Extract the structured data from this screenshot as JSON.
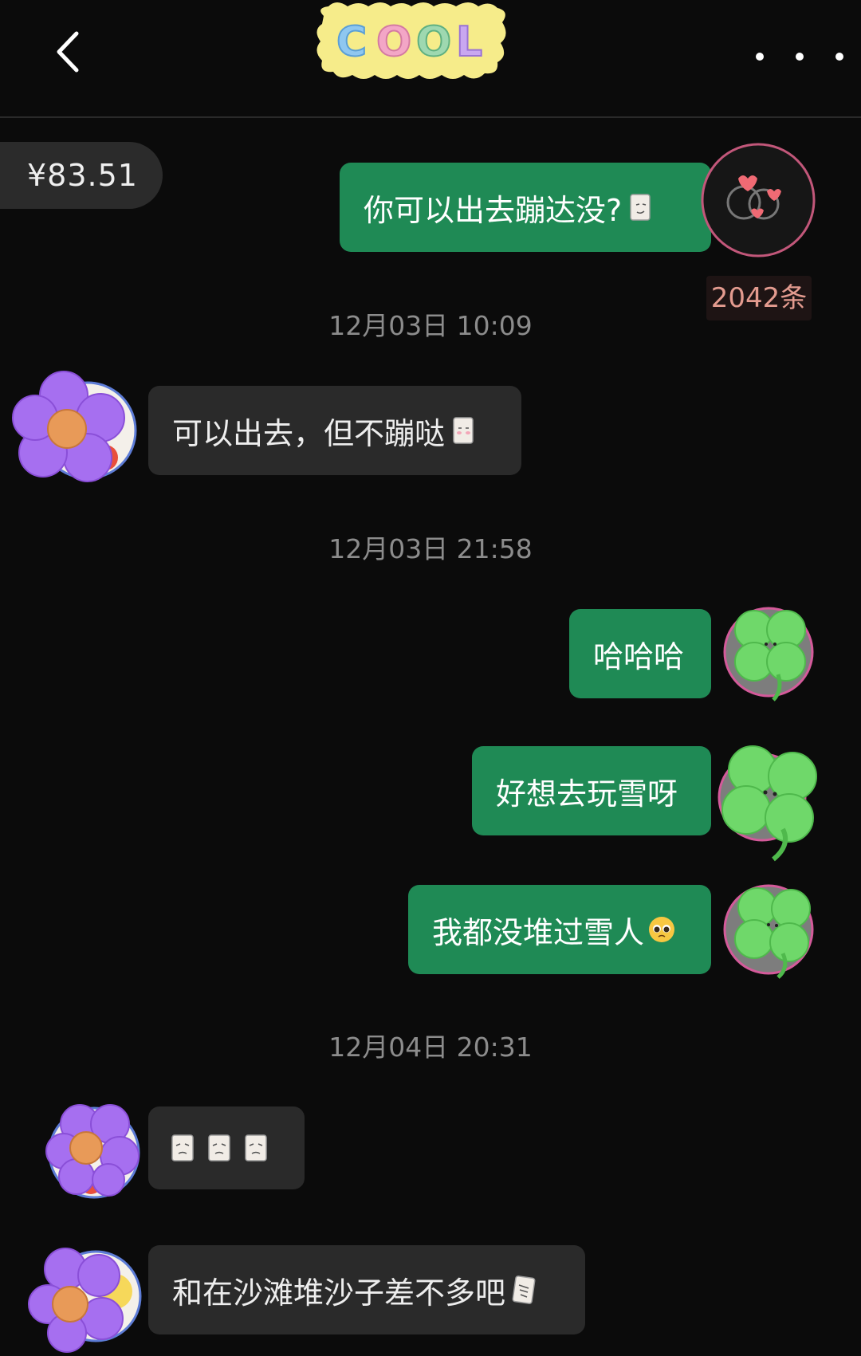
{
  "header": {
    "back_icon": "chevron-left-icon",
    "menu_icon": "more-dots-icon",
    "title_sticker": "COOL"
  },
  "overlay": {
    "money": "¥83.51",
    "count": "2042条"
  },
  "messages": [
    {
      "side": "out",
      "text": "你可以出去蹦达没?",
      "emoji": "square-face-sticker"
    },
    {
      "type": "time",
      "text": "12月03日 10:09"
    },
    {
      "side": "in",
      "text": "可以出去，但不蹦哒",
      "emoji": "square-face-sticker"
    },
    {
      "type": "time",
      "text": "12月03日 21:58"
    },
    {
      "side": "out",
      "text": "哈哈哈"
    },
    {
      "side": "out",
      "text": "好想去玩雪呀"
    },
    {
      "side": "out",
      "text": "我都没堆过雪人",
      "emoji": "pleading-face"
    },
    {
      "type": "time",
      "text": "12月04日 20:31"
    },
    {
      "side": "in",
      "text": "",
      "emoji": "three-square-face-stickers"
    },
    {
      "side": "in",
      "text": "和在沙滩堆沙子差不多吧",
      "emoji": "square-face-sticker"
    }
  ],
  "colors": {
    "outgoing_bubble": "#1f8a55",
    "incoming_bubble": "#2a2a2a",
    "background": "#0b0b0b",
    "timestamp": "#8c8c8c"
  }
}
